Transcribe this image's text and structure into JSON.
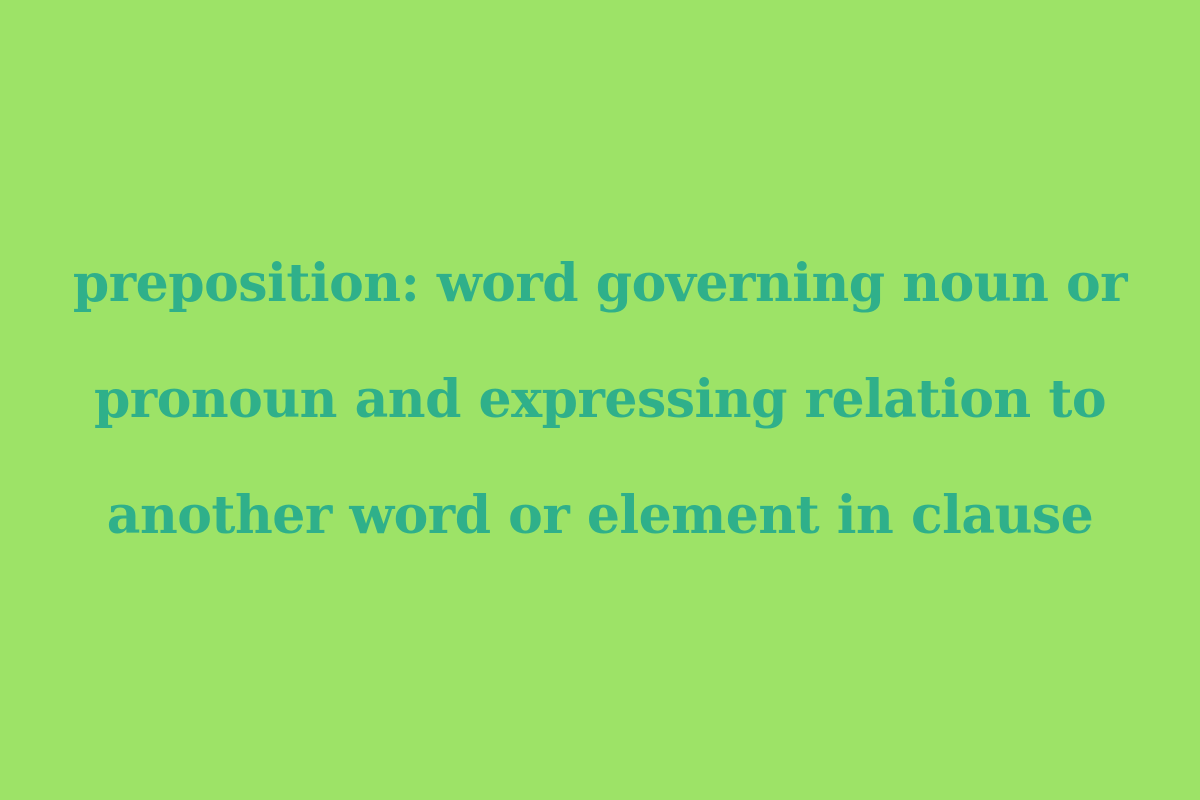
{
  "colors": {
    "background": "#9de367",
    "text": "#2fb08a"
  },
  "definition": {
    "lines": [
      "preposition: word governing noun or",
      "pronoun and expressing relation to",
      "another word or element in clause"
    ]
  }
}
